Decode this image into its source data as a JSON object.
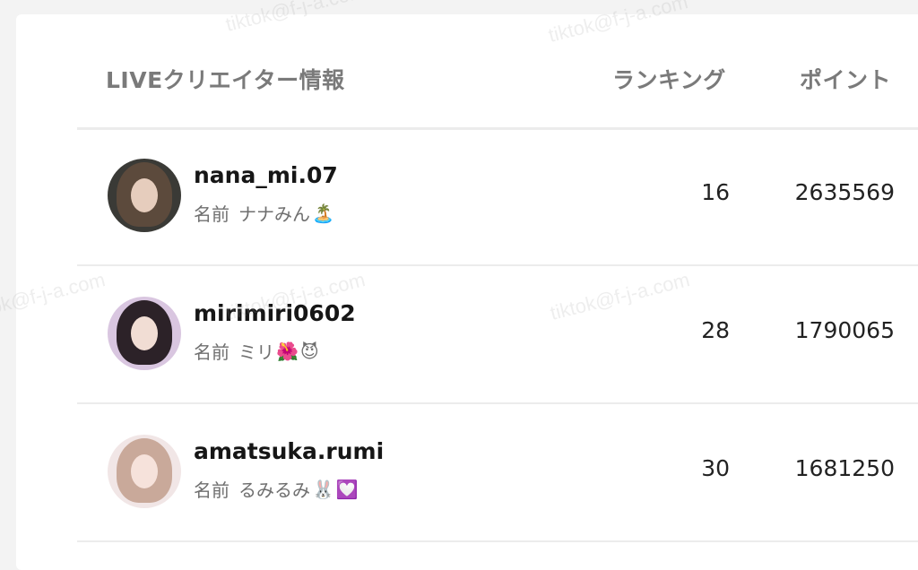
{
  "table": {
    "columns": {
      "creator": "LIVEクリエイター情報",
      "rank": "ランキング",
      "points": "ポイント"
    },
    "name_label": "名前",
    "rows": [
      {
        "username": "nana_mi.07",
        "display_name": "ナナみん",
        "emojis": [
          "🏝️"
        ],
        "rank": "16",
        "points": "2635569",
        "avatar_colors": {
          "bg": "#3a3a36",
          "hair": "#5c4a3c",
          "face": "#e6cdbd"
        }
      },
      {
        "username": "mirimiri0602",
        "display_name": "ミリ",
        "emojis": [
          "🌺",
          "😈"
        ],
        "rank": "28",
        "points": "1790065",
        "avatar_colors": {
          "bg": "#d9c6e0",
          "hair": "#2c2228",
          "face": "#f1ddd4"
        }
      },
      {
        "username": "amatsuka.rumi",
        "display_name": "るみるみ",
        "emojis": [
          "🐰",
          "💟"
        ],
        "rank": "30",
        "points": "1681250",
        "avatar_colors": {
          "bg": "#f1e6e6",
          "hair": "#c9a99a",
          "face": "#f6e2db"
        }
      }
    ]
  },
  "watermark_text": "tiktok@f-j-a.com"
}
